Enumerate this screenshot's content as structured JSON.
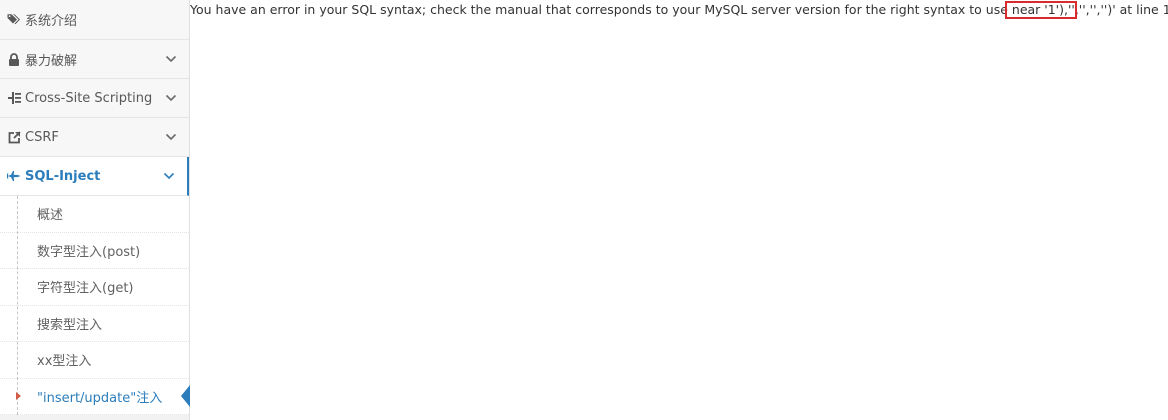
{
  "sidebar": {
    "items": [
      {
        "label": "系统介绍",
        "icon": "tags-icon",
        "has_chevron": false
      },
      {
        "label": "暴力破解",
        "icon": "lock-icon",
        "has_chevron": true
      },
      {
        "label": "Cross-Site Scripting",
        "icon": "indent-icon",
        "has_chevron": true
      },
      {
        "label": "CSRF",
        "icon": "external-link-icon",
        "has_chevron": true
      },
      {
        "label": "SQL-Inject",
        "icon": "fighter-jet-icon",
        "has_chevron": true,
        "expanded": true
      }
    ],
    "submenu": [
      {
        "label": "概述"
      },
      {
        "label": "数字型注入(post)"
      },
      {
        "label": "字符型注入(get)"
      },
      {
        "label": "搜索型注入"
      },
      {
        "label": "xx型注入"
      },
      {
        "label": "\"insert/update\"注入",
        "current": true
      }
    ]
  },
  "main": {
    "error_message": "You have an error in your SQL syntax; check the manual that corresponds to your MySQL server version for the right syntax to use near '1'),'','','','')' at line 1"
  },
  "colors": {
    "accent": "#2b7dbc",
    "highlight_border": "#d92b2b",
    "caret": "#d15b47",
    "sidebar_bg": "#f2f2f2"
  }
}
